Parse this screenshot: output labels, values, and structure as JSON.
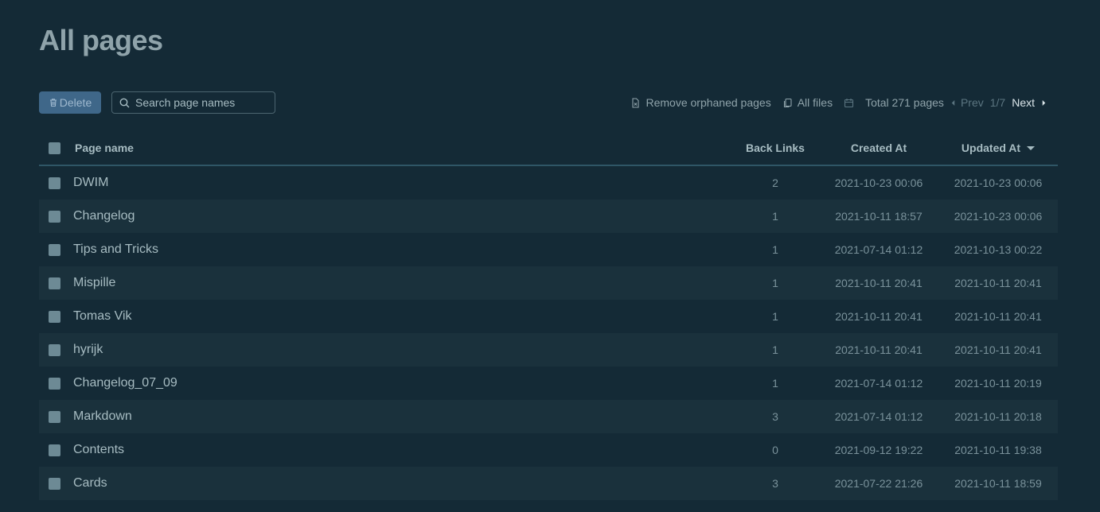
{
  "page": {
    "title": "All pages"
  },
  "toolbar": {
    "delete_label": "Delete",
    "search_placeholder": "Search page names",
    "remove_orphaned_label": "Remove orphaned pages",
    "all_files_label": "All files",
    "total_label": "Total 271 pages",
    "prev_label": "Prev",
    "page_indicator": "1/7",
    "next_label": "Next"
  },
  "table": {
    "headers": {
      "name": "Page name",
      "back_links": "Back Links",
      "created_at": "Created At",
      "updated_at": "Updated At"
    },
    "rows": [
      {
        "name": "DWIM",
        "back_links": "2",
        "created": "2021-10-23 00:06",
        "updated": "2021-10-23 00:06"
      },
      {
        "name": "Changelog",
        "back_links": "1",
        "created": "2021-10-11 18:57",
        "updated": "2021-10-23 00:06"
      },
      {
        "name": "Tips and Tricks",
        "back_links": "1",
        "created": "2021-07-14 01:12",
        "updated": "2021-10-13 00:22"
      },
      {
        "name": "Mispille",
        "back_links": "1",
        "created": "2021-10-11 20:41",
        "updated": "2021-10-11 20:41"
      },
      {
        "name": "Tomas Vik",
        "back_links": "1",
        "created": "2021-10-11 20:41",
        "updated": "2021-10-11 20:41"
      },
      {
        "name": "hyrijk",
        "back_links": "1",
        "created": "2021-10-11 20:41",
        "updated": "2021-10-11 20:41"
      },
      {
        "name": "Changelog_07_09",
        "back_links": "1",
        "created": "2021-07-14 01:12",
        "updated": "2021-10-11 20:19"
      },
      {
        "name": "Markdown",
        "back_links": "3",
        "created": "2021-07-14 01:12",
        "updated": "2021-10-11 20:18"
      },
      {
        "name": "Contents",
        "back_links": "0",
        "created": "2021-09-12 19:22",
        "updated": "2021-10-11 19:38"
      },
      {
        "name": "Cards",
        "back_links": "3",
        "created": "2021-07-22 21:26",
        "updated": "2021-10-11 18:59"
      }
    ]
  }
}
